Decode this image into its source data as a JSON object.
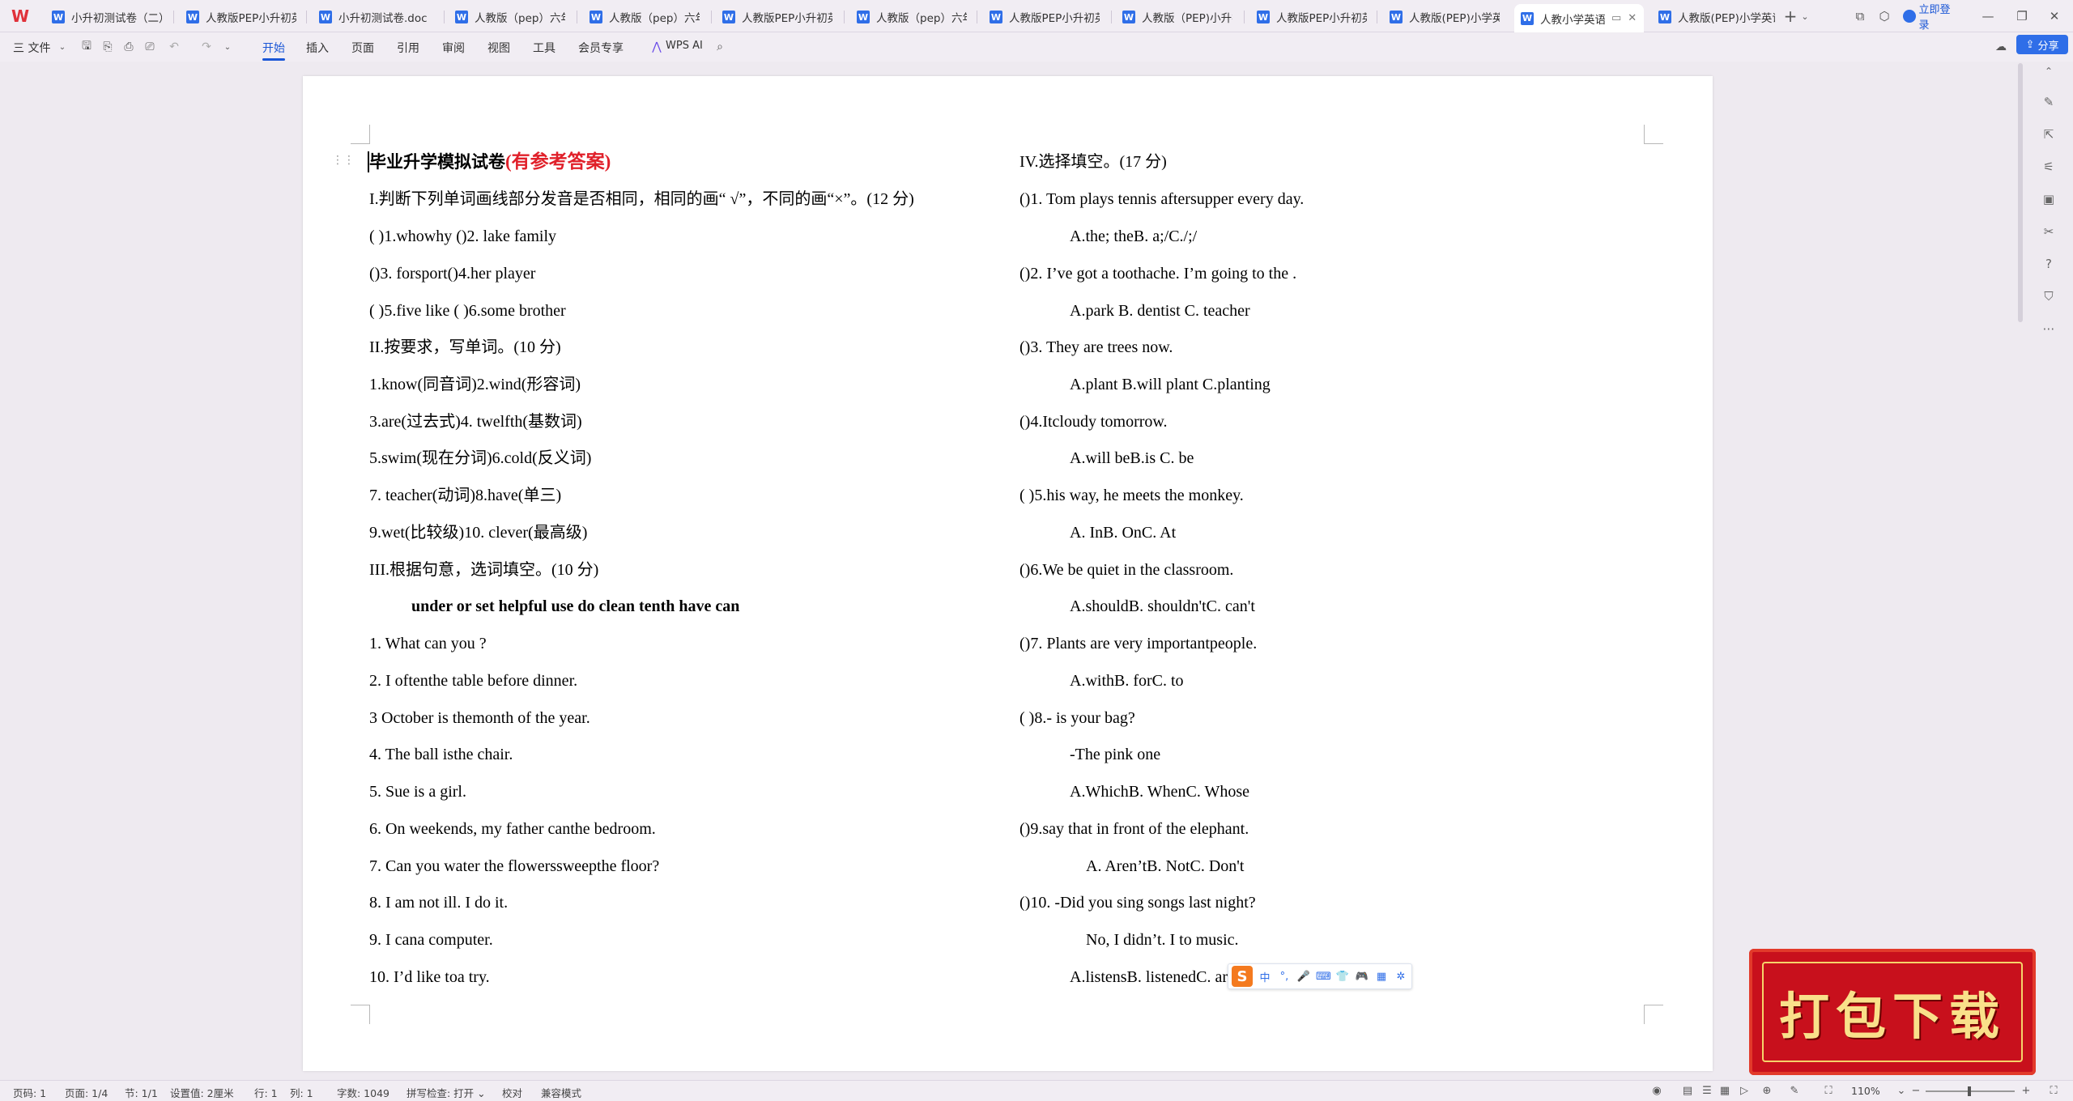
{
  "tabs": [
    {
      "label": "小升初测试卷（二）.d",
      "icon": "W"
    },
    {
      "label": "人教版PEP小升初英语",
      "icon": "W"
    },
    {
      "label": "小升初测试卷.doc",
      "icon": "W"
    },
    {
      "label": "人教版（pep）六年级",
      "icon": "W"
    },
    {
      "label": "人教版（pep）六年级",
      "icon": "W"
    },
    {
      "label": "人教版PEP小升初英语",
      "icon": "W"
    },
    {
      "label": "人教版（pep）六年级",
      "icon": "W"
    },
    {
      "label": "人教版PEP小升初英语",
      "icon": "W"
    },
    {
      "label": "人教版（PEP)小升初-",
      "icon": "W"
    },
    {
      "label": "人教版PEP小升初英语",
      "icon": "W"
    },
    {
      "label": "人教版(PEP)小学英语",
      "icon": "W"
    },
    {
      "label": "人教小学英语毕",
      "icon": "W"
    },
    {
      "label": "人教版(PEP)小学英语",
      "icon": "W"
    }
  ],
  "tab_close": "✕",
  "new_tab": "+",
  "titlebar": {
    "login": "立即登录"
  },
  "menu": {
    "file": "三 文件",
    "items": [
      "开始",
      "插入",
      "页面",
      "引用",
      "审阅",
      "视图",
      "工具",
      "会员专享"
    ],
    "wps_ai": "WPS AI",
    "share": "分享"
  },
  "doc": {
    "title": "毕业升学模拟试卷",
    "title_red": "(有参考答案)",
    "left": [
      "I.判断下列单词画线部分发音是否相同，相同的画“ √”，不同的画“×”。(12 分)",
      "(           )1.whowhy                          ()2. lake         family",
      "()3. forsport()4.her            player",
      "(           )5.five         like                          (           )6.some         brother",
      "II.按要求，写单词。(10 分)",
      "1.know(同音词)2.wind(形容词)",
      "3.are(过去式)4. twelfth(基数词)",
      "5.swim(现在分词)6.cold(反义词)",
      "7. teacher(动词)8.have(单三)",
      "9.wet(比较级)10. clever(最高级)",
      "III.根据句意，选词填空。(10 分)",
      "1. What can you ?",
      "2. I oftenthe table before dinner.",
      "3 October is themonth of the year.",
      "4. The ball isthe chair.",
      "5. Sue is a girl.",
      "6. On weekends, my father canthe bedroom.",
      "7. Can you water the flowerssweepthe floor?",
      "8. I am not ill. I do it.",
      "9. I cana computer.",
      "10. I’d like toa try."
    ],
    "word_bank": "under or set helpful use do clean tenth have can",
    "right": [
      "IV.选择填空。(17 分)",
      "()1. Tom plays tennis aftersupper every day.",
      "A.the; theB. a;/C./;/",
      "()2. I’ve got a toothache. I’m going to the .",
      "A.park                 B. dentist              C. teacher",
      "()3. They are trees now.",
      "A.plant                   B.will plant                    C.planting",
      "()4.Itcloudy tomorrow.",
      "A.will beB.is                 C. be",
      "(           )5.his way, he meets the monkey.",
      "A. InB. OnC. At",
      "()6.We be quiet in the classroom.",
      "A.shouldB. shouldn'tC. can't",
      "()7. Plants are very importantpeople.",
      "A.withB. forC. to",
      "(           )8.- is your bag?",
      "-The pink one",
      "A.WhichB. WhenC. Whose",
      "()9.say that in front of the elephant.",
      "A. Aren’tB. NotC. Don't",
      "()10. -Did you sing songs last night?",
      "No, I didn’t. I to music.",
      "A.listensB. listenedC. ar"
    ]
  },
  "ime": {
    "logo": "S",
    "buttons": [
      "中",
      "°,",
      "🎤",
      "⌨",
      "👕",
      "🎮",
      "▦",
      "✲"
    ]
  },
  "banner": "打包下载",
  "status": {
    "page_no": "页码: 1",
    "pages": "页面: 1/4",
    "section": "节: 1/1",
    "setting": "设置值: 2厘米",
    "row": "行: 1",
    "col": "列: 1",
    "words": "字数: 1049",
    "spell": "拼写检查: 打开 ⌄",
    "proof": "校对",
    "compat": "兼容模式",
    "zoom": "110%"
  }
}
